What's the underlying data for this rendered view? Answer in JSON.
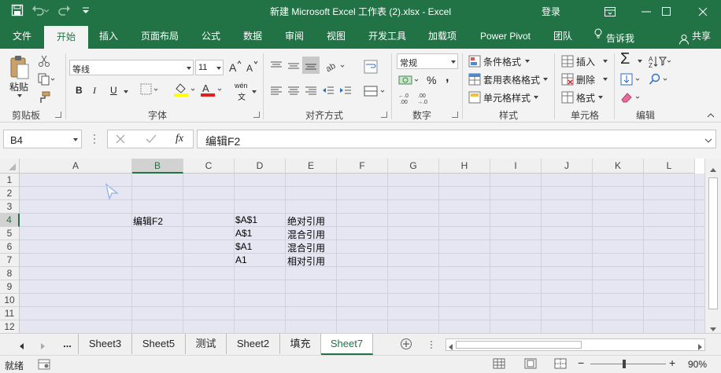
{
  "window": {
    "title": "新建 Microsoft Excel 工作表 (2).xlsx  -  Excel",
    "login": "登录",
    "accent_color": "#217346"
  },
  "ribbon_tabs": [
    "文件",
    "开始",
    "插入",
    "页面布局",
    "公式",
    "数据",
    "审阅",
    "视图",
    "开发工具",
    "加载项",
    "Power Pivot",
    "团队"
  ],
  "active_tab": "开始",
  "tell_me": "告诉我",
  "share": "共享",
  "ribbon": {
    "clipboard": {
      "paste": "粘贴",
      "label": "剪贴板"
    },
    "font": {
      "name": "等线",
      "size": "11",
      "bold": "B",
      "italic": "I",
      "underline": "U",
      "wen": "wén",
      "label": "字体"
    },
    "alignment": {
      "label": "对齐方式"
    },
    "number": {
      "format": "常规",
      "percent": "%",
      "comma": ",",
      "label": "数字"
    },
    "styles": {
      "conditional": "条件格式",
      "table": "套用表格格式",
      "cell": "单元格样式",
      "label": "样式"
    },
    "cells": {
      "insert": "插入",
      "delete": "删除",
      "format": "格式",
      "label": "单元格"
    },
    "editing": {
      "sigma": "Σ",
      "label": "编辑"
    }
  },
  "formula_bar": {
    "name_box": "B4",
    "fx": "fx",
    "formula": "编辑F2"
  },
  "grid": {
    "columns": [
      "A",
      "B",
      "C",
      "D",
      "E",
      "F",
      "G",
      "H",
      "I",
      "J",
      "K",
      "L"
    ],
    "rows": [
      "1",
      "2",
      "3",
      "4",
      "5",
      "6",
      "7",
      "8",
      "9",
      "10",
      "11",
      "12"
    ],
    "selected_column": "B",
    "selected_row": "4",
    "cells": {
      "B4": "编辑F2",
      "D4": "$A$1",
      "E4": "绝对引用",
      "D5": "A$1",
      "E5": "混合引用",
      "D6": "$A1",
      "E6": "混合引用",
      "D7": "A1",
      "E7": "相对引用"
    }
  },
  "sheet_tabs": [
    "...",
    "Sheet3",
    "Sheet5",
    "测试",
    "Sheet2",
    "填充",
    "Sheet7"
  ],
  "active_sheet": "Sheet7",
  "status": {
    "ready": "就绪",
    "zoom_minus": "−",
    "zoom_plus": "+",
    "zoom": "90%",
    "zoom_level": 0.9
  }
}
